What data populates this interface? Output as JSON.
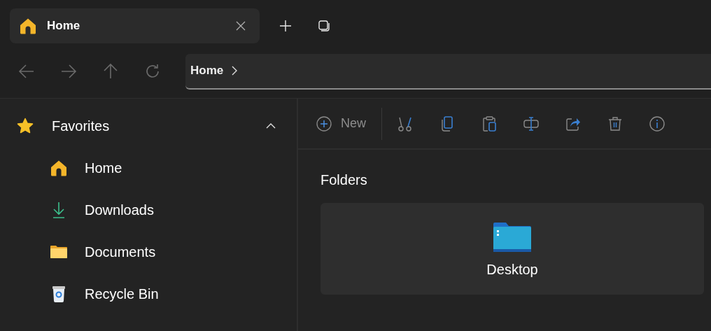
{
  "tabs": [
    {
      "label": "Home",
      "selected": true
    }
  ],
  "address": {
    "segments": [
      "Home"
    ]
  },
  "sidebar": {
    "sections": [
      {
        "label": "Favorites",
        "expanded": true,
        "children": [
          {
            "label": "Home",
            "kind": "home"
          },
          {
            "label": "Downloads",
            "kind": "downloads"
          },
          {
            "label": "Documents",
            "kind": "documents"
          },
          {
            "label": "Recycle Bin",
            "kind": "recycle"
          }
        ]
      }
    ]
  },
  "toolbar": {
    "new_label": "New"
  },
  "content": {
    "heading": "Folders",
    "folders": [
      {
        "label": "Desktop",
        "kind": "desktop"
      }
    ]
  }
}
